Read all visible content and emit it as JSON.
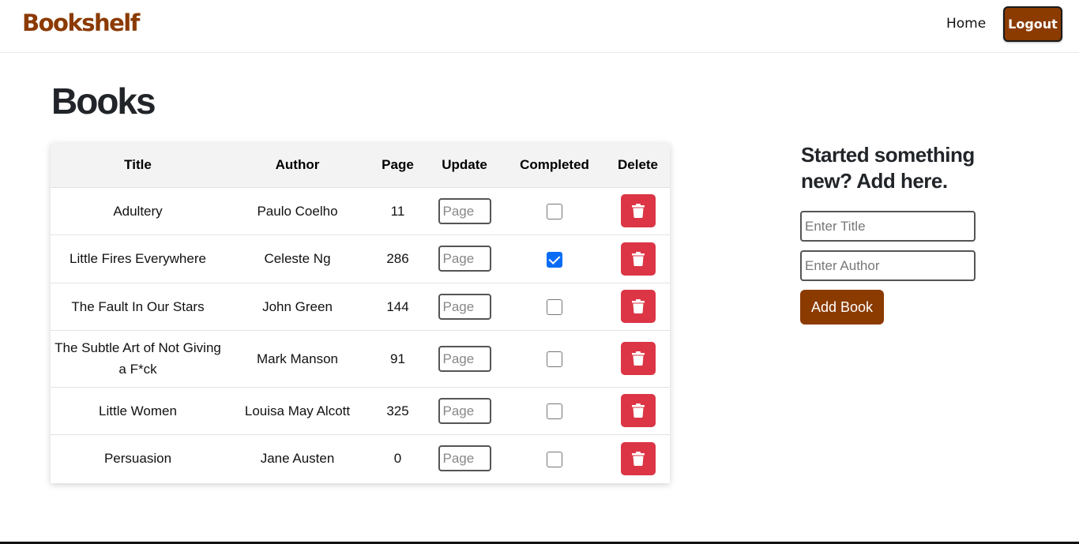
{
  "app": {
    "brand": "Bookshelf",
    "nav": {
      "home": "Home",
      "logout": "Logout"
    }
  },
  "main": {
    "title": "Books",
    "table": {
      "columns": [
        "Title",
        "Author",
        "Page",
        "Update",
        "Completed",
        "Delete"
      ],
      "rows": [
        {
          "title": "Adultery",
          "author": "Paulo Coelho",
          "page": "11",
          "update_placeholder": "Page",
          "completed": false,
          "delete_icon": "trash-icon"
        },
        {
          "title": "Little Fires Everywhere",
          "author": "Celeste Ng",
          "page": "286",
          "update_placeholder": "Page",
          "completed": true,
          "delete_icon": "trash-icon"
        },
        {
          "title": "The Fault In Our Stars",
          "author": "John Green",
          "page": "144",
          "update_placeholder": "Page",
          "completed": false,
          "delete_icon": "trash-icon"
        },
        {
          "title": "The Subtle Art of Not Giving a F*ck",
          "author": "Mark Manson",
          "page": "91",
          "update_placeholder": "Page",
          "completed": false,
          "delete_icon": "trash-icon"
        },
        {
          "title": "Little Women",
          "author": "Louisa May Alcott",
          "page": "325",
          "update_placeholder": "Page",
          "completed": false,
          "delete_icon": "trash-icon"
        },
        {
          "title": "Persuasion",
          "author": "Jane Austen",
          "page": "0",
          "update_placeholder": "Page",
          "completed": false,
          "delete_icon": "trash-icon"
        }
      ]
    }
  },
  "add_form": {
    "heading": "Started something new? Add here.",
    "title_placeholder": "Enter Title",
    "author_placeholder": "Enter Author",
    "submit_label": "Add Book"
  },
  "colors": {
    "brand": "#8b3a00",
    "danger": "#dc3545",
    "checkbox_checked": "#0a6cf5"
  }
}
